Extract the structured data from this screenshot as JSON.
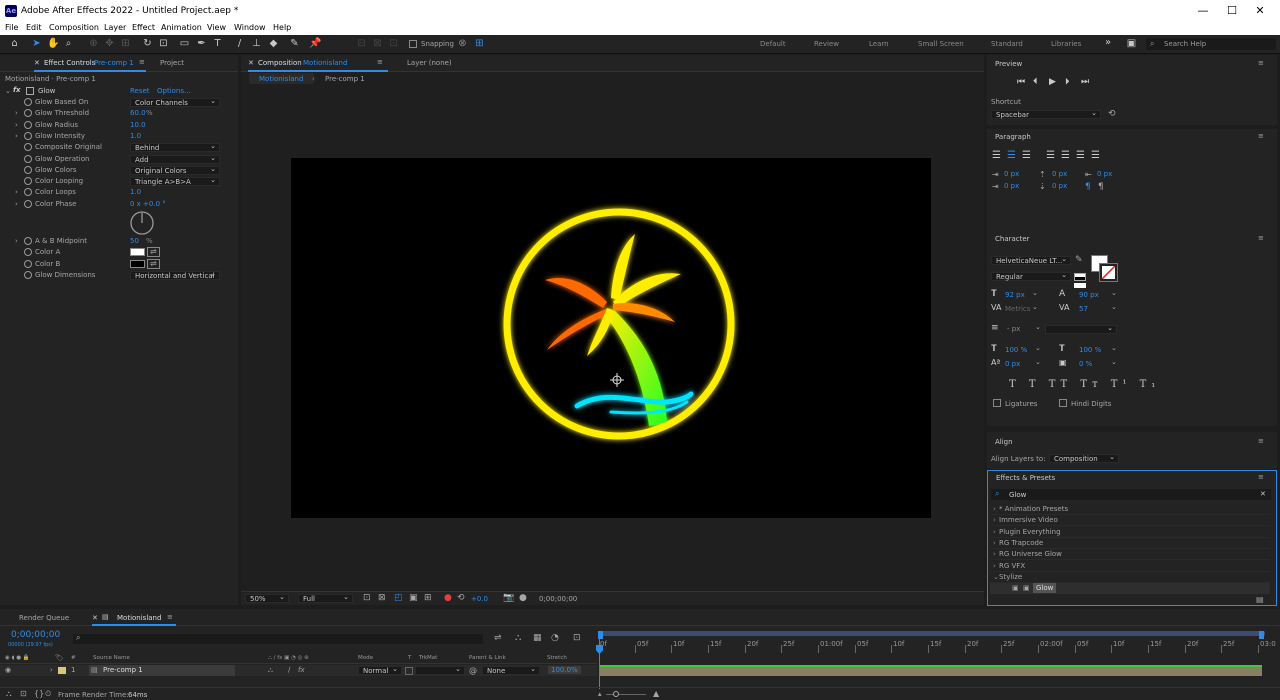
{
  "app": {
    "title": "Adobe After Effects 2022 - Untitled Project.aep *",
    "icon_label": "Ae"
  },
  "window_controls": {
    "minimize": "—",
    "maximize": "☐",
    "close": "✕"
  },
  "menu": [
    "File",
    "Edit",
    "Composition",
    "Layer",
    "Effect",
    "Animation",
    "View",
    "Window",
    "Help"
  ],
  "toolbar": {
    "snapping_label": "Snapping",
    "workspaces": [
      "Default",
      "Review",
      "Learn",
      "Small Screen",
      "Standard",
      "Libraries"
    ],
    "more": "»",
    "search_placeholder": "Search Help"
  },
  "effect_controls": {
    "tab_prefix": "Effect Controls",
    "tab_target": "Pre-comp 1",
    "project_tab": "Project",
    "breadcrumb": "Motionisland · Pre-comp 1",
    "effect_name": "Glow",
    "reset": "Reset",
    "options": "Options...",
    "props": [
      {
        "name": "Glow Based On",
        "value": "Color Channels",
        "kind": "dropdown"
      },
      {
        "name": "Glow Threshold",
        "value": "60.0",
        "unit": "%",
        "kind": "num"
      },
      {
        "name": "Glow Radius",
        "value": "10.0",
        "kind": "num"
      },
      {
        "name": "Glow Intensity",
        "value": "1.0",
        "kind": "num"
      },
      {
        "name": "Composite Original",
        "value": "Behind",
        "kind": "dropdown"
      },
      {
        "name": "Glow Operation",
        "value": "Add",
        "kind": "dropdown"
      },
      {
        "name": "Glow Colors",
        "value": "Original Colors",
        "kind": "dropdown"
      },
      {
        "name": "Color Looping",
        "value": "Triangle A>B>A",
        "kind": "dropdown"
      },
      {
        "name": "Color Loops",
        "value": "1.0",
        "kind": "num"
      },
      {
        "name": "Color Phase",
        "value": "0 x +0.0 °",
        "kind": "num"
      }
    ],
    "props2": [
      {
        "name": "A & B Midpoint",
        "value": "50",
        "unit": "%",
        "kind": "num"
      },
      {
        "name": "Color A",
        "kind": "swatch",
        "color": "#ffffff"
      },
      {
        "name": "Color B",
        "kind": "swatch",
        "color": "#000000"
      },
      {
        "name": "Glow Dimensions",
        "value": "Horizontal and Vertical",
        "kind": "dropdown"
      }
    ]
  },
  "composition": {
    "tab_prefix": "Composition",
    "tab_name": "Motionisland",
    "layer_tab": "Layer (none)",
    "crumb1": "Motionisland",
    "crumb2": "Pre-comp 1",
    "zoom": "50%",
    "quality": "Full",
    "exposure": "+0.0",
    "timecode": "0;00;00;00"
  },
  "preview": {
    "title": "Preview",
    "shortcut_label": "Shortcut",
    "shortcut_value": "Spacebar"
  },
  "paragraph": {
    "title": "Paragraph",
    "fields": [
      "0 px",
      "0 px",
      "0 px",
      "0 px",
      "0 px"
    ]
  },
  "character": {
    "title": "Character",
    "font": "HelveticaNeue LT...",
    "style": "Regular",
    "size": "92 px",
    "leading": "90 px",
    "kerning": "Metrics",
    "tracking": "57",
    "stroke": "- px",
    "vscale": "100 %",
    "hscale": "100 %",
    "baseline": "0 px",
    "tsume": "0 %",
    "ligatures": "Ligatures",
    "hindi": "Hindi Digits"
  },
  "align": {
    "title": "Align",
    "layers_to": "Align Layers to:",
    "target": "Composition"
  },
  "effects_presets": {
    "title": "Effects & Presets",
    "search": "Glow",
    "items": [
      "* Animation Presets",
      "Immersive Video",
      "Plugin Everything",
      "RG Trapcode",
      "RG Universe Glow",
      "RG VFX",
      "Stylize"
    ],
    "child": "Glow"
  },
  "timeline": {
    "render_queue": "Render Queue",
    "comp_tab": "Motionisland",
    "timecode": "0;00;00;00",
    "fps": "00000 (29.97 fps)",
    "cols": {
      "num": "#",
      "source": "Source Name",
      "mode": "Mode",
      "t": "T",
      "trkmat": "TrkMat",
      "parent": "Parent & Link",
      "stretch": "Stretch"
    },
    "layer": {
      "num": "1",
      "name": "Pre-comp 1",
      "mode": "Normal",
      "parent": "None",
      "stretch": "100.0%"
    },
    "ticks": [
      "0f",
      "05f",
      "10f",
      "15f",
      "20f",
      "25f",
      "01:00f",
      "05f",
      "10f",
      "15f",
      "20f",
      "25f",
      "02:00f",
      "05f",
      "10f",
      "15f",
      "20f",
      "25f",
      "03:0"
    ],
    "render_time_label": "Frame Render Time:",
    "render_time_value": "64ms"
  },
  "colors": {
    "accent": "#2d8ceb",
    "neon_yellow": "#ffee00",
    "neon_orange": "#ff6a00",
    "neon_green": "#33ff22",
    "neon_cyan": "#00e5ff"
  }
}
